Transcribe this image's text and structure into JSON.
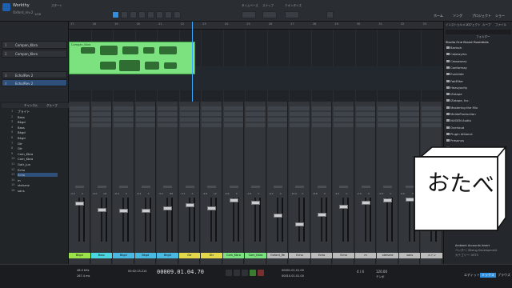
{
  "window": {
    "title": "Workthy",
    "subtitle": "Oxford_rev.2",
    "song_label": "スタート"
  },
  "toolbar": {
    "timebase_label": "タイムベース",
    "snap_label": "スナップ",
    "quantize_label": "クオンタイズ",
    "snap_value": "1/16",
    "right_labels": [
      "ホーム",
      "ソング",
      "プロジェクト",
      "ショー"
    ]
  },
  "tracks": [
    {
      "num": "1",
      "name": "Compan_Kbra"
    },
    {
      "num": "2",
      "name": "Compan_Kbra"
    },
    {
      "num": "3",
      "name": "Echo/Rev 2"
    },
    {
      "num": "4",
      "name": "Echo/Rev 2"
    }
  ],
  "ruler": {
    "ticks": [
      "17",
      "18",
      "19",
      "20",
      "21",
      "22",
      "23",
      "24",
      "25",
      "26",
      "27",
      "28",
      "29",
      "30",
      "31",
      "32",
      "33"
    ]
  },
  "clip": {
    "label": "Compan_Kbra"
  },
  "browser": {
    "tabs": [
      "インストゥルメント",
      "エフェクト",
      "ループ",
      "ファイル"
    ],
    "filter_label": "フォルダー",
    "header": "Studio One Brand Essentials",
    "items": [
      "Bartsch",
      "Cakewyrks",
      "Cassowary",
      "Conformay",
      "Eventide",
      "FabFilter",
      "Heavyocity",
      "iZotope",
      "iZotope, Inc.",
      "Mastering the Mix",
      "MeldaProduction",
      "NUGEN Audio",
      "Overloud",
      "Plugin Alliance",
      "Presonus",
      "Sonnox"
    ],
    "footer": {
      "label": "Ambient Accounts Insert",
      "vendor": "ベンダー: Mixing Development",
      "cat": "カテゴリー: VST3"
    }
  },
  "mixer_list": {
    "header": [
      "チャンネル",
      "グループ"
    ],
    "channels": [
      "ブライト",
      "Bass",
      "Bkgd",
      "Bass",
      "Bkgd",
      "Bkgd",
      "Gtr",
      "Gtr",
      "Com_Kbra",
      "Com_Kbra",
      "Gatr_Jun",
      "Echo",
      "Echo",
      "m",
      "steisme",
      "sans"
    ]
  },
  "strips": [
    {
      "name": "Bkgd",
      "color": "#9be24a",
      "vol": "-2.2",
      "pan": "C"
    },
    {
      "name": "Bass",
      "color": "#4ad7e2",
      "vol": "-6.0",
      "pan": "L8"
    },
    {
      "name": "Bkgd",
      "color": "#4ab9e2",
      "vol": "-6.4",
      "pan": "C"
    },
    {
      "name": "Bkgd",
      "color": "#4ab9e2",
      "vol": "-6.4",
      "pan": "C"
    },
    {
      "name": "Bkgd",
      "color": "#4ab9e2",
      "vol": "-5.2",
      "pan": "R6"
    },
    {
      "name": "Gtr",
      "color": "#e2d84a",
      "vol": "-3.1",
      "pan": "C"
    },
    {
      "name": "Gtr",
      "color": "#e2d84a",
      "vol": "-4.8",
      "pan": "L2"
    },
    {
      "name": "Com_Kbra",
      "color": "#7be27f",
      "vol": "-0.6",
      "pan": "C"
    },
    {
      "name": "Com_Kbra",
      "color": "#7be27f",
      "vol": "-1.8",
      "pan": "C"
    },
    {
      "name": "Oxford_Re",
      "color": "#bbbbbb",
      "vol": "-9.2",
      "pan": "C"
    },
    {
      "name": "Echo",
      "color": "#bbbbbb",
      "vol": "-14.2",
      "pan": "C"
    },
    {
      "name": "Echo",
      "color": "#bbbbbb",
      "vol": "-8.8",
      "pan": "C"
    },
    {
      "name": "Echo",
      "color": "#bbbbbb",
      "vol": "-4.0",
      "pan": "C"
    },
    {
      "name": "m",
      "color": "#bbbbbb",
      "vol": "-2.0",
      "pan": "C"
    },
    {
      "name": "steisme",
      "color": "#bbbbbb",
      "vol": "-0.5",
      "pan": "C"
    },
    {
      "name": "sans",
      "color": "#bbbbbb",
      "vol": "0.0",
      "pan": "C"
    },
    {
      "name": "メイン",
      "color": "#bbbbbb",
      "vol": "0.0",
      "pan": ""
    }
  ],
  "transport": {
    "sample_rate": "48.0 kHz",
    "latency": "267.4 ms",
    "time_label": "00:02:15.214",
    "position": "00009.01.04.70",
    "loop_start": "00001.01.01.00",
    "loop_end": "00010.01.01.00",
    "tempo": "120.00",
    "signature": "4 / 4",
    "metronome_label": "テンポ",
    "right_tabs": [
      "エディット",
      "ミックス",
      "ブラウズ"
    ]
  },
  "sticker": {
    "text": "おたべ"
  }
}
